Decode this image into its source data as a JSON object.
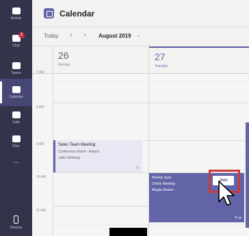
{
  "rail": {
    "items": [
      {
        "label": "Activity",
        "icon": "bell-icon"
      },
      {
        "label": "Chat",
        "icon": "chat-icon",
        "badge": "1"
      },
      {
        "label": "Teams",
        "icon": "teams-icon"
      },
      {
        "label": "Calendar",
        "icon": "calendar-icon",
        "active": true
      },
      {
        "label": "Calls",
        "icon": "phone-icon"
      },
      {
        "label": "Files",
        "icon": "file-icon"
      },
      {
        "label": "...",
        "icon": "more-icon"
      },
      {
        "label": "Devices",
        "icon": "device-icon"
      }
    ]
  },
  "header": {
    "title": "Calendar"
  },
  "toolbar": {
    "today_label": "Today",
    "prev": "‹",
    "next": "›",
    "month": "August 2019",
    "chevron": "⌄"
  },
  "days": [
    {
      "num": "26",
      "name": "Monday"
    },
    {
      "num": "27",
      "name": "Tuesday"
    }
  ],
  "times": [
    "7 AM",
    "8 AM",
    "9 AM",
    "10 AM",
    "11 AM"
  ],
  "events": {
    "sales": {
      "title": "Sales Team Meeting",
      "line1": "Conference Room - Adams",
      "line2": "Lidia Holloway",
      "sync": "↻"
    },
    "weekly": {
      "title": "Weekly Sync",
      "line1": "Online Meeting",
      "line2": "Megan Bowen",
      "join": "Join",
      "sync": "↻ ▸"
    }
  },
  "colors": {
    "accent": "#6264a7",
    "rail": "#33344a",
    "highlight": "#c93a3a"
  }
}
